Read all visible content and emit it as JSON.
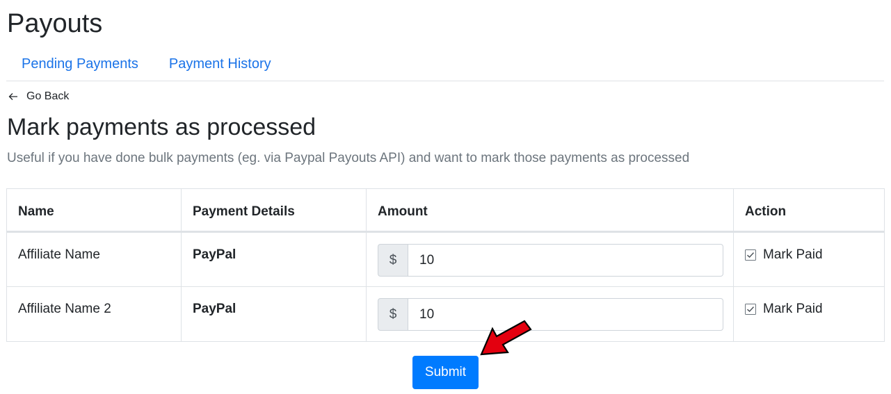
{
  "page": {
    "title": "Payouts"
  },
  "tabs": [
    {
      "label": "Pending Payments"
    },
    {
      "label": "Payment History"
    }
  ],
  "back_link": {
    "label": "Go Back",
    "icon": "arrow-left-icon"
  },
  "section": {
    "title": "Mark payments as processed",
    "description": "Useful if you have done bulk payments (eg. via Paypal Payouts API) and want to mark those payments as processed"
  },
  "table": {
    "headers": [
      "Name",
      "Payment Details",
      "Amount",
      "Action"
    ],
    "rows": [
      {
        "name": "Affiliate Name",
        "payment_details": "PayPal",
        "currency": "$",
        "amount": "10",
        "action": "Mark Paid",
        "checked": true
      },
      {
        "name": "Affiliate Name 2",
        "payment_details": "PayPal",
        "currency": "$",
        "amount": "10",
        "action": "Mark Paid",
        "checked": true
      }
    ]
  },
  "submit": {
    "label": "Submit"
  },
  "colors": {
    "link": "#1a73e8",
    "primary": "#007bff",
    "annotation_arrow": "#e3000f"
  }
}
